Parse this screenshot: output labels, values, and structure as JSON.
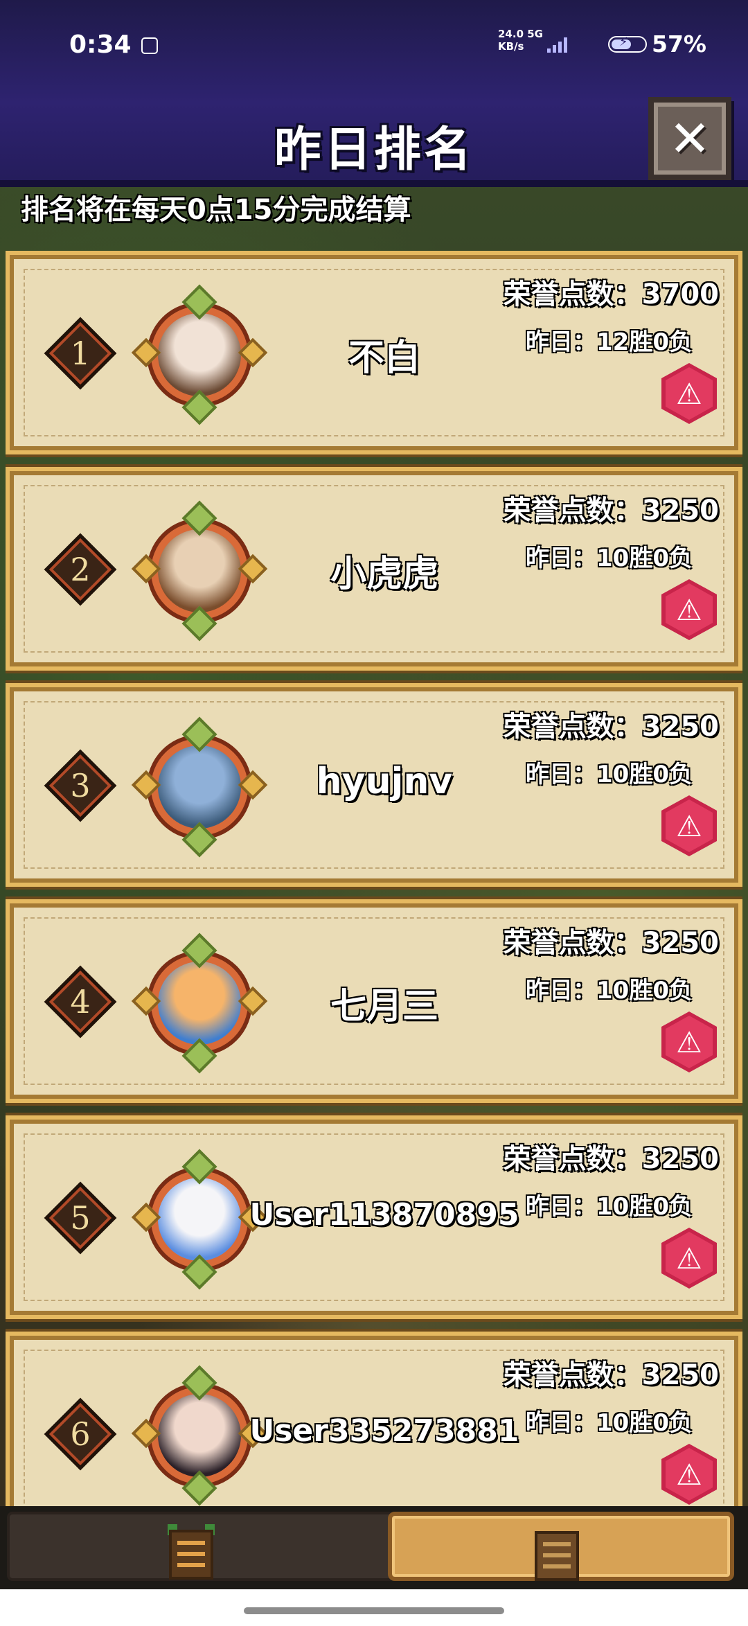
{
  "status_bar": {
    "time": "0:34",
    "net_speed": "24.0",
    "net_unit": "KB/s",
    "net_type": "5G",
    "battery": "57%"
  },
  "header": {
    "title": "昨日排名",
    "close_icon": "close-icon"
  },
  "notice": "排名将在每天0点15分完成结算",
  "ranking": [
    {
      "rank": "1",
      "name": "不白",
      "honor": "荣誉点数：3700",
      "record": "昨日：12胜0负",
      "avatar": "avatar-boy-brown-hair"
    },
    {
      "rank": "2",
      "name": "小虎虎",
      "honor": "荣誉点数：3250",
      "record": "昨日：10胜0负",
      "avatar": "avatar-girl-brown-hair"
    },
    {
      "rank": "3",
      "name": "hyujnv",
      "honor": "荣誉点数：3250",
      "record": "昨日：10胜0负",
      "avatar": "avatar-sea-sky"
    },
    {
      "rank": "4",
      "name": "七月三",
      "honor": "荣誉点数：3250",
      "record": "昨日：10胜0负",
      "avatar": "avatar-shiba-dog"
    },
    {
      "rank": "5",
      "name": "User113870895",
      "honor": "荣誉点数：3250",
      "record": "昨日：10胜0负",
      "avatar": "avatar-white-hair-blue-eyes"
    },
    {
      "rank": "6",
      "name": "User335273881",
      "honor": "荣誉点数：3250",
      "record": "昨日：10胜0负",
      "avatar": "avatar-black-hair-girl"
    }
  ],
  "report_icon": "warning-icon",
  "tabs": [
    {
      "name": "tab-daily-ranking",
      "icon": "board-icon",
      "active": false
    },
    {
      "name": "tab-yesterday-ranking",
      "icon": "board-icon",
      "active": true
    }
  ],
  "colors": {
    "header_bg": "#2e2370",
    "card_bg": "#eadcb6",
    "report_red": "#c8244a",
    "active_tab": "#d7a255"
  }
}
